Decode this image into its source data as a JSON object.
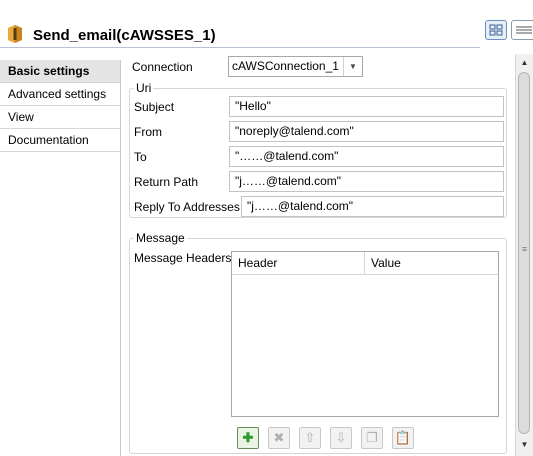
{
  "header": {
    "title": "Send_email(cAWSSES_1)",
    "logo_icon": "aws-ses-icon",
    "accent": "#e59c2b"
  },
  "sidebar": {
    "items": [
      {
        "label": "Basic settings",
        "active": true
      },
      {
        "label": "Advanced settings",
        "active": false
      },
      {
        "label": "View",
        "active": false
      },
      {
        "label": "Documentation",
        "active": false
      }
    ]
  },
  "connection": {
    "label": "Connection",
    "value": "cAWSConnection_1"
  },
  "uri": {
    "title": "Uri",
    "subject_label": "Subject",
    "subject_value": "\"Hello\"",
    "from_label": "From",
    "from_value": "\"noreply@talend.com\"",
    "to_label": "To",
    "to_value": "\"……@talend.com\"",
    "return_label": "Return Path",
    "return_value": "\"j……@talend.com\"",
    "reply_label": "Reply To Addresses",
    "reply_value": "\"j……@talend.com\""
  },
  "message": {
    "title": "Message",
    "headers_label": "Message Headers",
    "columns": [
      "Header",
      "Value"
    ],
    "rows": []
  },
  "toolbar": {
    "buttons": [
      "add-icon",
      "delete-icon",
      "move-up-icon",
      "move-down-icon",
      "copy-icon",
      "paste-icon"
    ]
  }
}
